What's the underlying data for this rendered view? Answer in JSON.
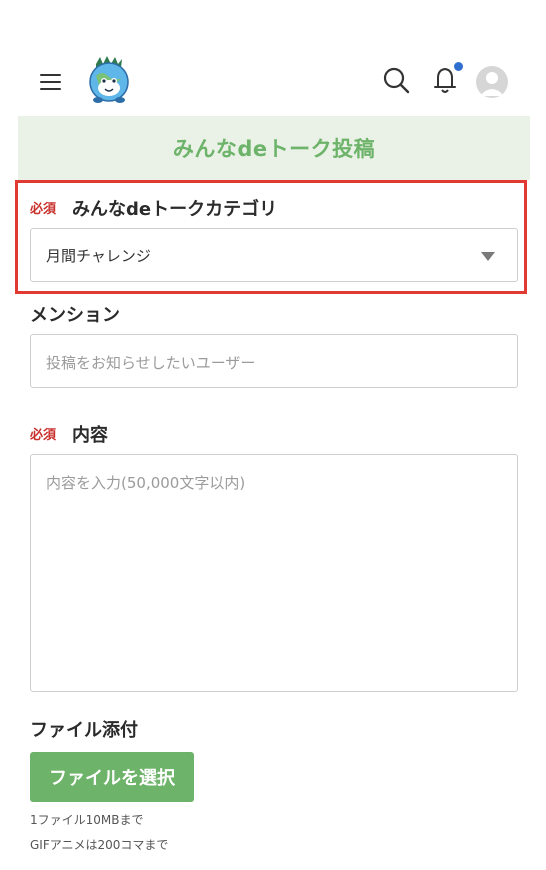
{
  "colors": {
    "accent_green": "#6db36a",
    "required_red": "#c9302c",
    "highlight_red": "#e13a32",
    "notification_blue": "#2f6fd0",
    "title_band_bg": "#eaf1e6"
  },
  "header": {
    "menu_icon": "hamburger-menu-icon",
    "logo": "mascot-logo",
    "search_icon": "search-icon",
    "bell_icon": "bell-icon",
    "avatar": "user-avatar-icon"
  },
  "page_title": "みんなdeトーク投稿",
  "category": {
    "required_badge": "必須",
    "label": "みんなdeトークカテゴリ",
    "selected": "月間チャレンジ"
  },
  "mention": {
    "label": "メンション",
    "placeholder": "投稿をお知らせしたいユーザー"
  },
  "content": {
    "required_badge": "必須",
    "label": "内容",
    "placeholder": "内容を入力(50,000文字以内)"
  },
  "attachment": {
    "label": "ファイル添付",
    "button_label": "ファイルを選択",
    "note_size": "1ファイル10MBまで",
    "note_gif": "GIFアニメは200コマまで"
  }
}
